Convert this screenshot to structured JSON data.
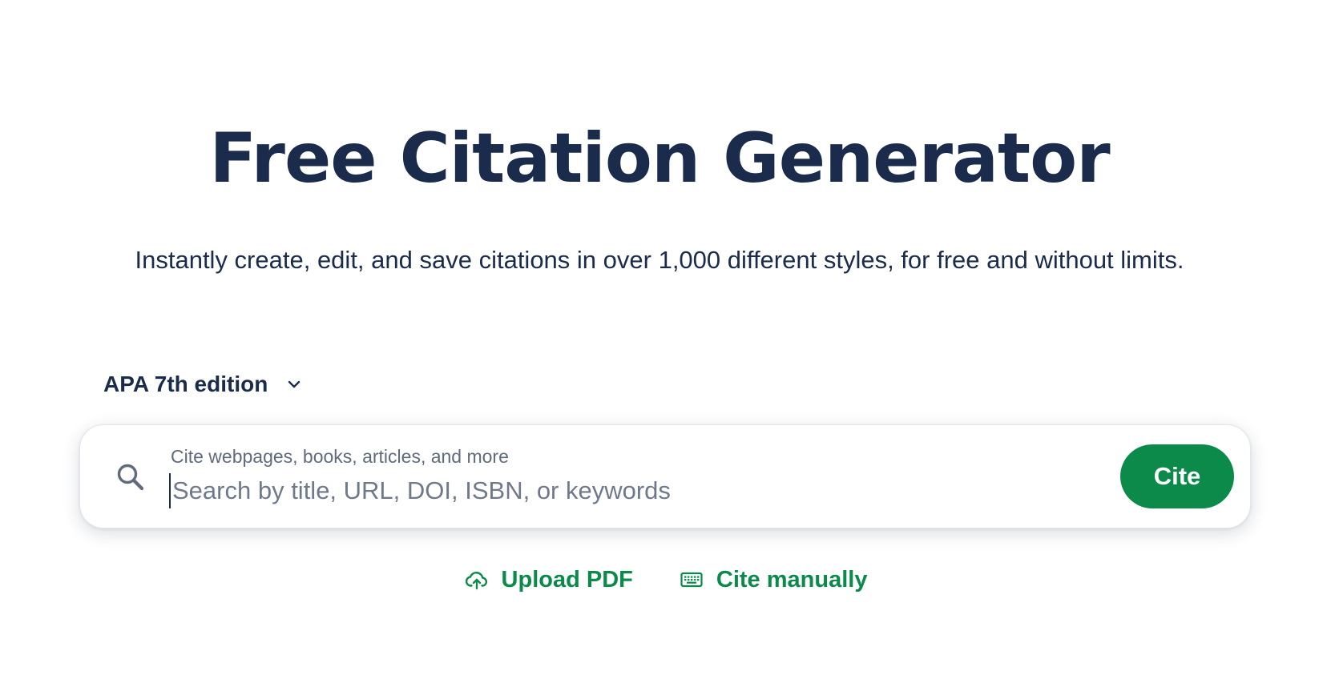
{
  "hero": {
    "title": "Free Citation Generator",
    "subtitle": "Instantly create, edit, and save citations in over 1,000 different styles, for free and without limits."
  },
  "style_selector": {
    "selected": "APA 7th edition",
    "icon": "chevron-down-icon"
  },
  "search": {
    "label": "Cite webpages, books, articles, and more",
    "placeholder": "Search by title, URL, DOI, ISBN, or keywords",
    "value": "",
    "icon": "search-icon",
    "button_label": "Cite"
  },
  "actions": {
    "upload_label": "Upload PDF",
    "upload_icon": "cloud-upload-icon",
    "manual_label": "Cite manually",
    "manual_icon": "keyboard-icon"
  },
  "colors": {
    "text_primary": "#1a2b4c",
    "accent_green": "#0b8a4a",
    "muted_text": "#5f6b7c",
    "background": "#ffffff"
  }
}
